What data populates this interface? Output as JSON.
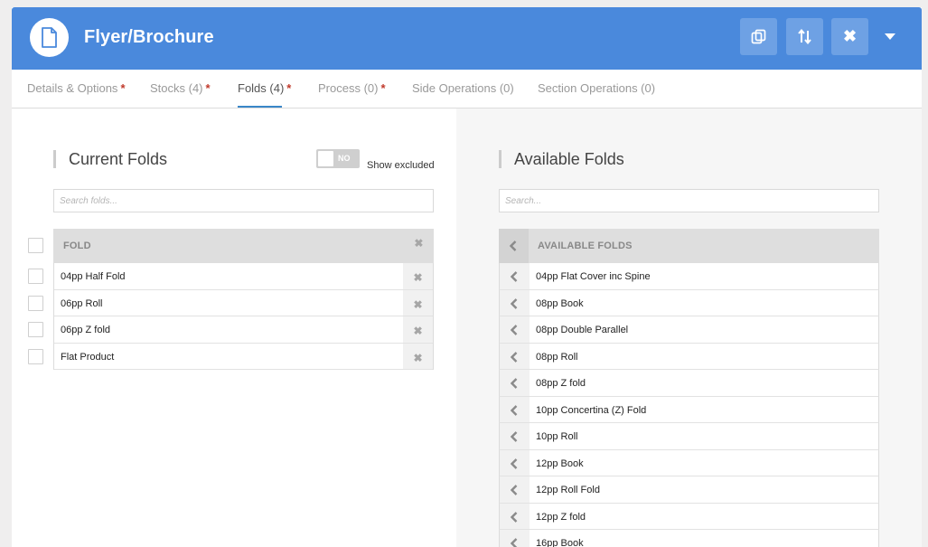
{
  "header": {
    "title": "Flyer/Brochure",
    "icon": "document-icon",
    "buttons": [
      {
        "name": "copy-button",
        "icon": "copy-icon"
      },
      {
        "name": "sort-button",
        "icon": "sort-icon"
      },
      {
        "name": "close-button",
        "icon": "close-icon",
        "glyph": "✖"
      }
    ],
    "color": "#4a89dc"
  },
  "tabs": [
    {
      "label": "Details & Options",
      "required": true,
      "star": "*"
    },
    {
      "label": "Stocks (4)",
      "required": true,
      "star": "*"
    },
    {
      "label": "Folds (4)",
      "required": true,
      "star": "*",
      "active": true
    },
    {
      "label": "Process (0)",
      "required": true,
      "star": "*"
    },
    {
      "label": "Side Operations (0)",
      "required": false
    },
    {
      "label": "Section Operations (0)",
      "required": false
    }
  ],
  "current": {
    "title": "Current Folds",
    "toggle_value": "NO",
    "toggle_label": "Show excluded",
    "search_placeholder": "Search folds...",
    "column_header": "FOLD",
    "remove_glyph": "✖",
    "rows": [
      "04pp Half Fold",
      "06pp Roll",
      "06pp Z fold",
      "Flat Product"
    ]
  },
  "available": {
    "title": "Available Folds",
    "search_placeholder": "Search...",
    "column_header": "AVAILABLE FOLDS",
    "rows": [
      "04pp Flat Cover inc Spine",
      "08pp Book",
      "08pp Double Parallel",
      "08pp Roll",
      "08pp Z fold",
      "10pp Concertina (Z) Fold",
      "10pp Roll",
      "12pp Book",
      "12pp Roll Fold",
      "12pp Z fold",
      "16pp Book"
    ]
  },
  "colors": {
    "accent": "#4a89dc",
    "required_star": "#c0392b",
    "tab_underline": "#3a87c8"
  }
}
